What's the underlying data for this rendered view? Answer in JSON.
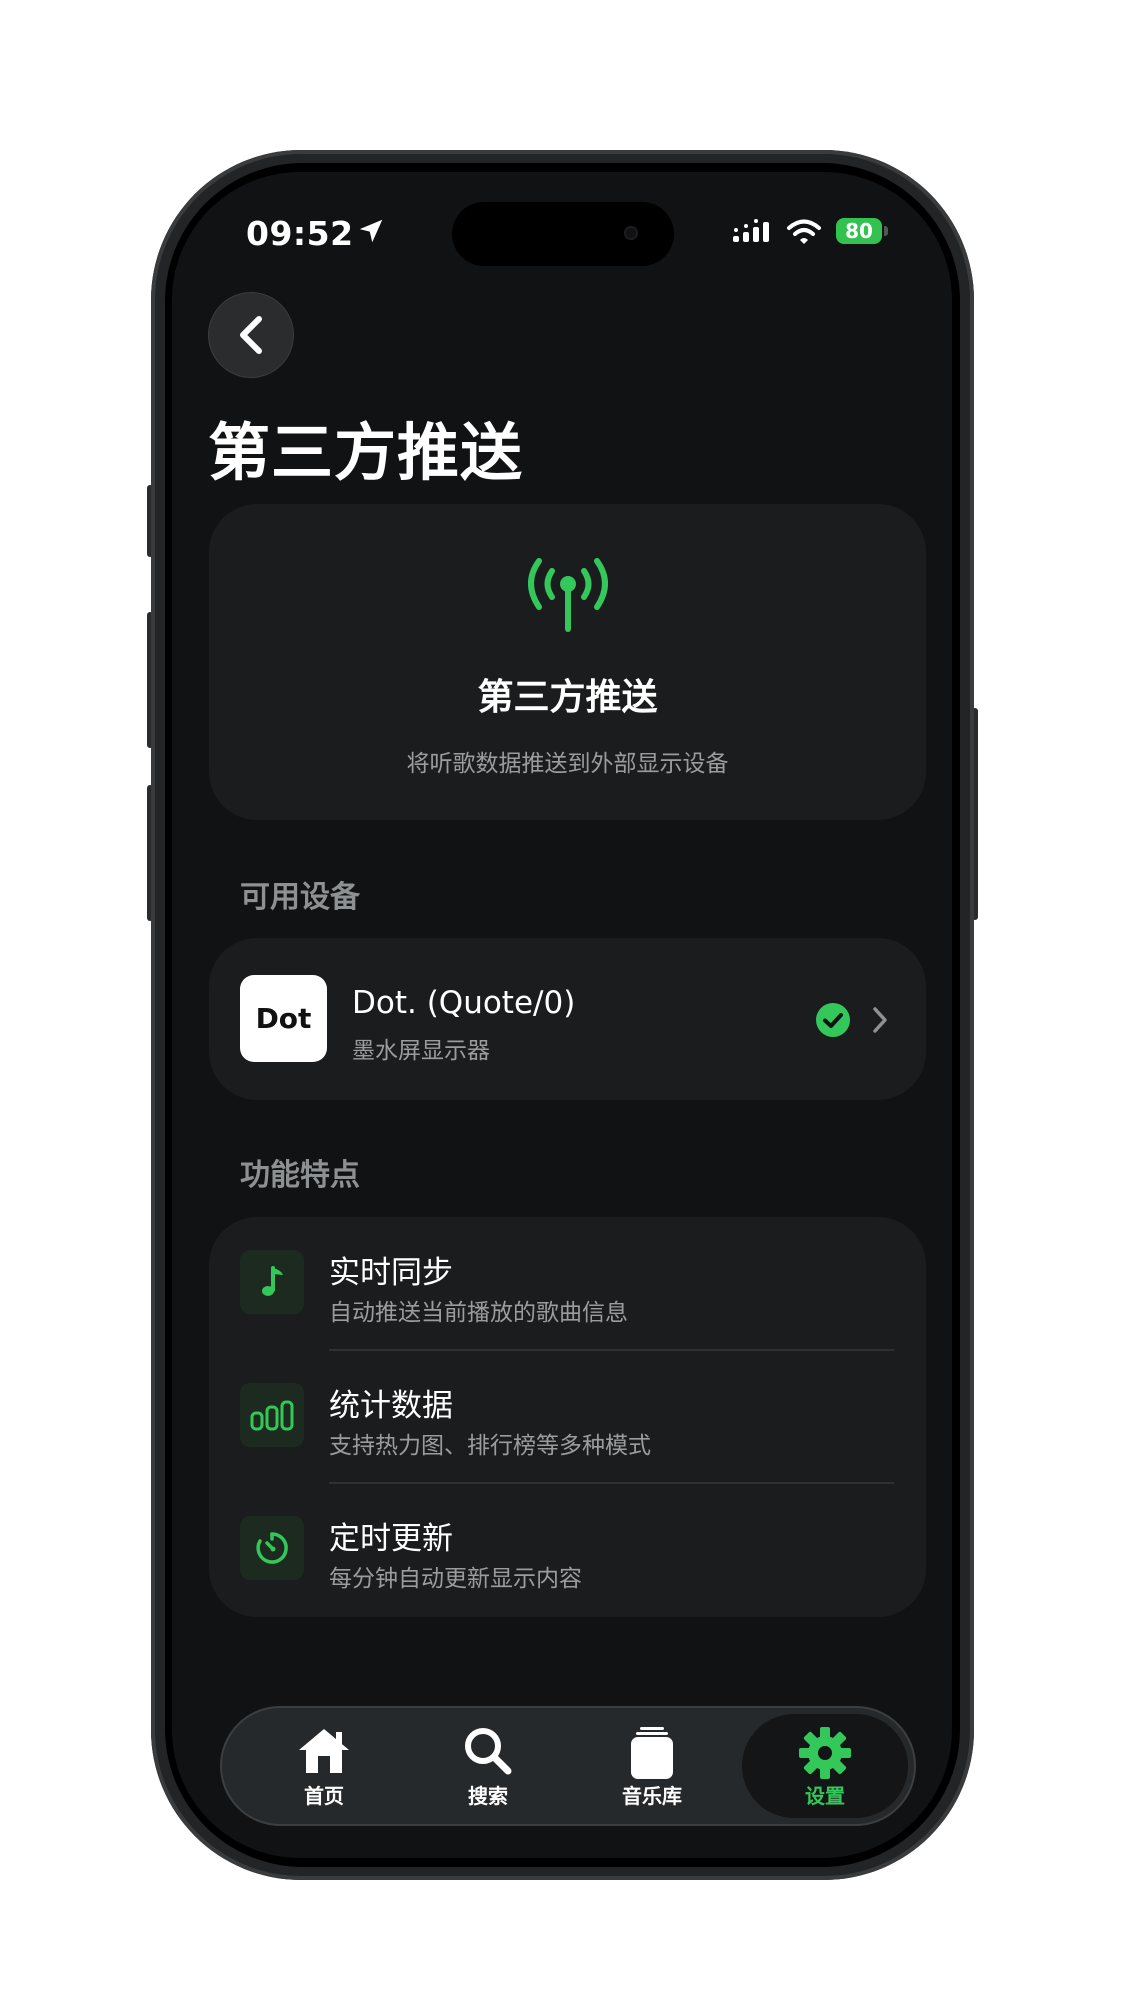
{
  "status_bar": {
    "time": "09:52",
    "battery": "80"
  },
  "header": {
    "back_icon": "chevron-left-icon",
    "title": "第三方推送"
  },
  "hero": {
    "icon": "antenna-icon",
    "title": "第三方推送",
    "subtitle": "将听歌数据推送到外部显示设备"
  },
  "devices_section": {
    "header": "可用设备",
    "items": [
      {
        "logo_text": "Dot",
        "name": "Dot. (Quote/0)",
        "description": "墨水屏显示器",
        "status_icon": "check-circle-icon"
      }
    ]
  },
  "features_section": {
    "header": "功能特点",
    "items": [
      {
        "icon": "music-note-icon",
        "title": "实时同步",
        "description": "自动推送当前播放的歌曲信息"
      },
      {
        "icon": "chart-icon",
        "title": "统计数据",
        "description": "支持热力图、排行榜等多种模式"
      },
      {
        "icon": "timer-icon",
        "title": "定时更新",
        "description": "每分钟自动更新显示内容"
      }
    ]
  },
  "tab_bar": {
    "tabs": [
      {
        "label": "首页",
        "icon": "home-icon",
        "active": false
      },
      {
        "label": "搜索",
        "icon": "search-icon",
        "active": false
      },
      {
        "label": "音乐库",
        "icon": "library-icon",
        "active": false
      },
      {
        "label": "设置",
        "icon": "gear-icon",
        "active": true
      }
    ]
  },
  "colors": {
    "accent": "#34c759",
    "background": "#101213",
    "card": "#1a1c1d"
  }
}
